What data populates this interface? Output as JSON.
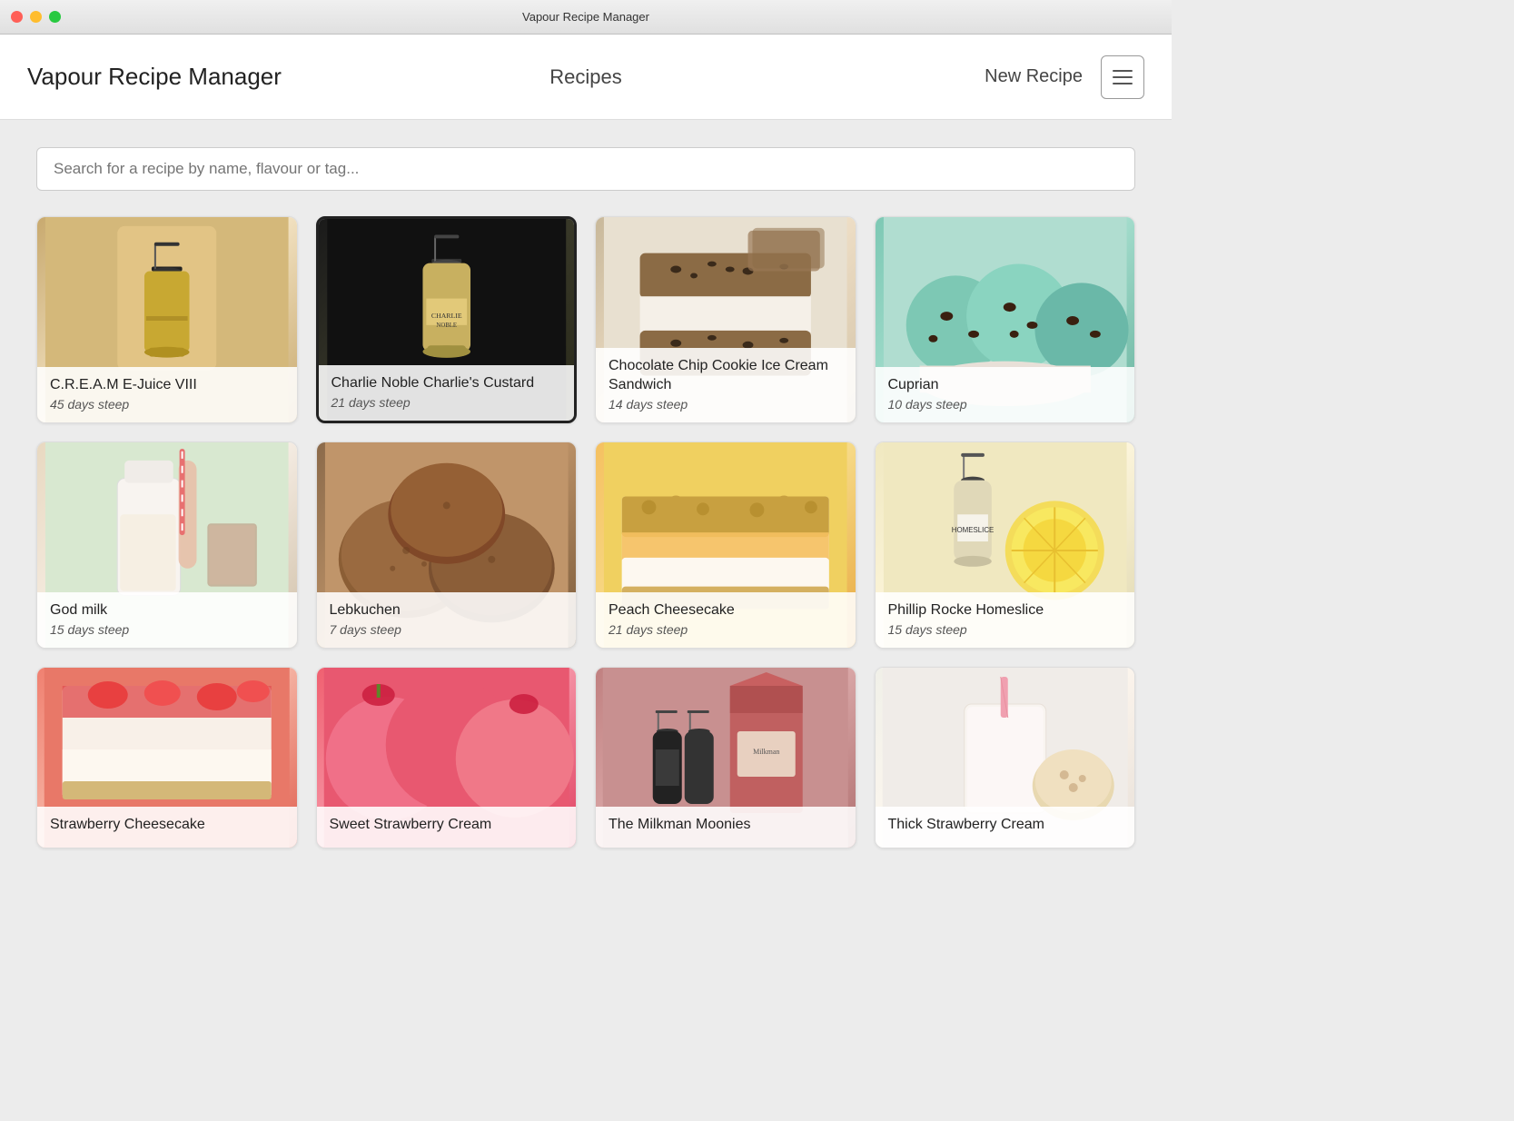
{
  "titlebar": {
    "title": "Vapour Recipe Manager"
  },
  "header": {
    "app_title": "Vapour Recipe Manager",
    "nav_title": "Recipes",
    "new_recipe_label": "New Recipe"
  },
  "search": {
    "placeholder": "Search for a recipe by name, flavour or tag..."
  },
  "recipes": [
    {
      "id": "cream",
      "name": "C.R.E.A.M E-Juice VIII",
      "steep": "45 days steep",
      "img_class": "img-cream",
      "overlay_class": "",
      "has_bottle": true,
      "bottle_color": "#c8a832"
    },
    {
      "id": "charlie",
      "name": "Charlie Noble Charlie's Custard",
      "steep": "21 days steep",
      "img_class": "img-charlie",
      "overlay_class": "",
      "has_bottle": true,
      "bottle_color": "#c8a832"
    },
    {
      "id": "cookie",
      "name": "Chocolate Chip Cookie Ice Cream Sandwich",
      "steep": "14 days steep",
      "img_class": "img-cookie",
      "overlay_class": "",
      "has_bottle": false
    },
    {
      "id": "cuprian",
      "name": "Cuprian",
      "steep": "10 days steep",
      "img_class": "img-cuprian",
      "overlay_class": "",
      "has_bottle": false
    },
    {
      "id": "godmilk",
      "name": "God milk",
      "steep": "15 days steep",
      "img_class": "img-godmilk",
      "overlay_class": "",
      "has_bottle": false
    },
    {
      "id": "lebkuchen",
      "name": "Lebkuchen",
      "steep": "7 days steep",
      "img_class": "img-lebkuchen",
      "overlay_class": "",
      "has_bottle": false
    },
    {
      "id": "peach",
      "name": "Peach Cheesecake",
      "steep": "21 days steep",
      "img_class": "img-peach",
      "overlay_class": "",
      "has_bottle": false
    },
    {
      "id": "phillip",
      "name": "Phillip Rocke Homeslice",
      "steep": "15 days steep",
      "img_class": "img-phillip",
      "overlay_class": "",
      "has_bottle": true,
      "bottle_color": "#e8c040"
    },
    {
      "id": "strawberry-cheese",
      "name": "Strawberry Cheesecake",
      "steep": "",
      "img_class": "img-strawberry-cheese",
      "overlay_class": "",
      "has_bottle": false,
      "partial": true
    },
    {
      "id": "sweet-strawberry",
      "name": "Sweet Strawberry Cream",
      "steep": "",
      "img_class": "img-sweet-strawberry",
      "overlay_class": "",
      "has_bottle": false,
      "partial": true
    },
    {
      "id": "milkman",
      "name": "The Milkman Moonies",
      "steep": "",
      "img_class": "img-milkman",
      "overlay_class": "",
      "has_bottle": true,
      "bottle_color": "#222",
      "partial": true
    },
    {
      "id": "thick-strawberry",
      "name": "Thick Strawberry Cream",
      "steep": "",
      "img_class": "img-thick-strawberry",
      "overlay_class": "",
      "has_bottle": false,
      "partial": true
    }
  ]
}
